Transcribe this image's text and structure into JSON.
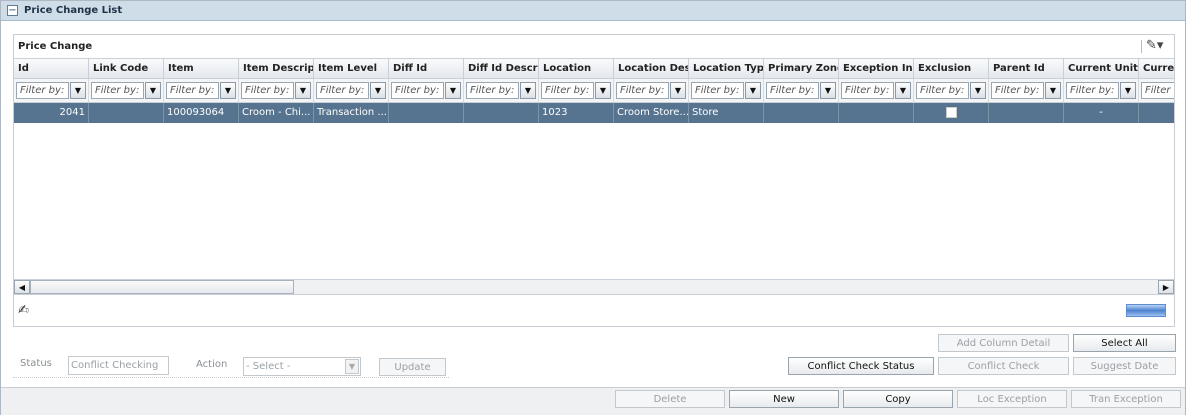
{
  "window": {
    "title": "Price Change List"
  },
  "panel": {
    "title": "Price Change"
  },
  "grid": {
    "filter_placeholder": "Filter by:",
    "columns": [
      "Id",
      "Link Code",
      "Item",
      "Item Descripti",
      "Item Level",
      "Diff Id",
      "Diff Id Descrip",
      "Location",
      "Location Desc",
      "Location Type",
      "Primary Zone",
      "Exception Ind",
      "Exclusion",
      "Parent Id",
      "Current Unit R",
      "Curren"
    ],
    "row": {
      "id": "2041",
      "link_code": "",
      "item": "100093064",
      "item_description": "Croom - Chi...",
      "item_level": "Transaction ...",
      "diff_id": "",
      "diff_id_description": "",
      "location": "1023",
      "location_description": "Croom Store...",
      "location_type": "Store",
      "primary_zone": "",
      "exception_ind": "",
      "exclusion_checked": false,
      "parent_id": "",
      "current_unit_retail": "-",
      "current": ""
    }
  },
  "controls": {
    "status_label": "Status",
    "status_value": "Conflict Checking",
    "action_label": "Action",
    "action_value": "- Select -",
    "update": "Update",
    "add_column_detail": "Add Column Detail",
    "select_all": "Select All",
    "conflict_check_status": "Conflict Check Status",
    "conflict_check": "Conflict Check",
    "suggest_date": "Suggest Date"
  },
  "footer": {
    "delete": "Delete",
    "new": "New",
    "copy": "Copy",
    "loc_exception": "Loc Exception",
    "tran_exception": "Tran Exception"
  },
  "colors": {
    "selected_row": "#56748f",
    "title_bar": "#cfdde9"
  }
}
